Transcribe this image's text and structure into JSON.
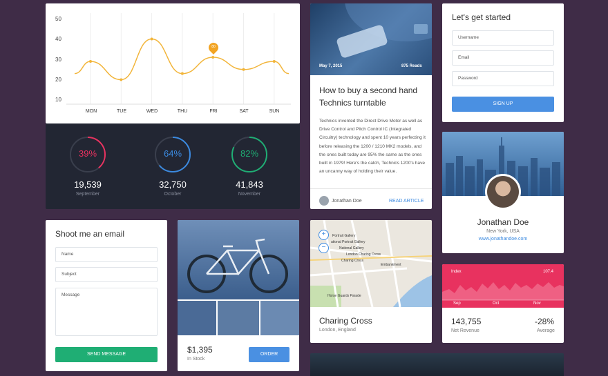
{
  "chart": {
    "y_ticks": [
      "50",
      "40",
      "30",
      "20",
      "10"
    ],
    "x_ticks": [
      "MON",
      "TUE",
      "WED",
      "THU",
      "FRI",
      "SAT",
      "SUN"
    ],
    "marker_value": "80",
    "colors": {
      "line": "#f2b53a",
      "marker": "#f2a423"
    }
  },
  "chart_data": {
    "type": "line",
    "categories": [
      "MON",
      "TUE",
      "WED",
      "THU",
      "FRI",
      "SAT",
      "SUN"
    ],
    "ylim": [
      10,
      50
    ],
    "series": [
      {
        "values": [
          29,
          20,
          40,
          23,
          31,
          25,
          29
        ]
      }
    ],
    "annotations": [
      {
        "x": "FRI",
        "label": "80"
      }
    ],
    "grid": true
  },
  "stats": [
    {
      "percent": "39%",
      "value": "19,539",
      "label": "September",
      "color": "#e8325f",
      "fraction": 0.39
    },
    {
      "percent": "64%",
      "value": "32,750",
      "label": "October",
      "color": "#3b8ae0",
      "fraction": 0.64
    },
    {
      "percent": "82%",
      "value": "41,843",
      "label": "November",
      "color": "#1fae74",
      "fraction": 0.82
    }
  ],
  "article": {
    "date": "May 7, 2015",
    "reads": "875 Reads",
    "title": "How to buy a second hand Technics turntable",
    "body": "Technics invented the Direct Drive Motor as well as Drive Control and Pitch Control IC (Integrated Circuitry) technology and spent 10 years perfecting it before releasing the 1200 / 1210 MK2 models, and the ones built today are 95% the same as the ones built in 1979! Here's the catch, Technics 1200's have an uncanny way of holding their value.",
    "author": "Jonathan Doe",
    "read_more": "READ ARTICLE"
  },
  "signup": {
    "title": "Let's get started",
    "username": "Username",
    "email": "Email",
    "password": "Password",
    "button": "SIGN UP"
  },
  "profile": {
    "name": "Jonathan Doe",
    "location": "New York, USA",
    "url": "www.jonathandoe.com"
  },
  "email_form": {
    "title": "Shoot me an email",
    "name": "Name",
    "subject": "Subject",
    "message": "Message",
    "button": "SEND MESSAGE"
  },
  "bike": {
    "price": "$1,395",
    "stock": "In Stock",
    "button": "ORDER"
  },
  "map": {
    "place": "Charing Cross",
    "address": "London, England",
    "labels": [
      "Portrait Gallery",
      "ational Portrait Gallery",
      "National Gallery",
      "London Charing Cross",
      "Charing Cross",
      "Embankment",
      "Horse Guards Parade"
    ]
  },
  "revenue": {
    "index_label": "Index",
    "top_value": "107.4",
    "months": [
      "Sep",
      "Oct",
      "Nov"
    ],
    "value": "143,755",
    "value_label": "Net Revenue",
    "change": "-28%",
    "change_label": "Average"
  }
}
